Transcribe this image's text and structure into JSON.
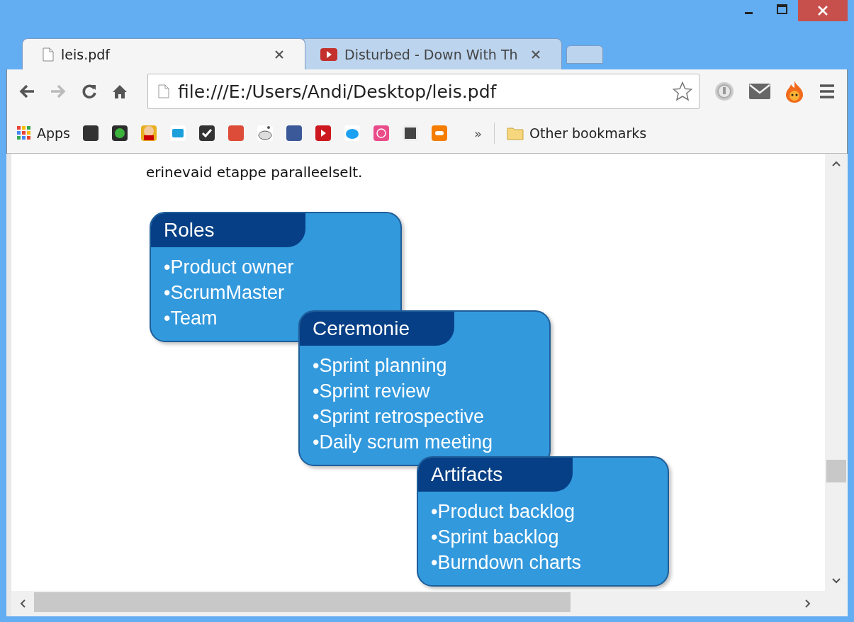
{
  "tabs": [
    {
      "title": "leis.pdf",
      "kind": "document",
      "selected": true
    },
    {
      "title": "Disturbed - Down With Th",
      "kind": "video",
      "selected": false
    }
  ],
  "toolbar": {
    "forward_disabled": true,
    "address": "file:///E:/Users/Andi/Desktop/leis.pdf"
  },
  "bookmarks": {
    "apps": "Apps",
    "overflow": "»",
    "other": "Other bookmarks"
  },
  "page": {
    "text": "erinevaid etappe paralleelselt.",
    "cards": [
      {
        "title": "Roles",
        "items": [
          "•Product owner",
          "•ScrumMaster",
          "•Team"
        ]
      },
      {
        "title": "Ceremonie",
        "items": [
          "•Sprint planning",
          "•Sprint review",
          "•Sprint retrospective",
          "•Daily scrum meeting"
        ]
      },
      {
        "title": "Artifacts",
        "items": [
          "•Product backlog",
          "•Sprint backlog",
          "•Burndown charts"
        ]
      }
    ]
  }
}
